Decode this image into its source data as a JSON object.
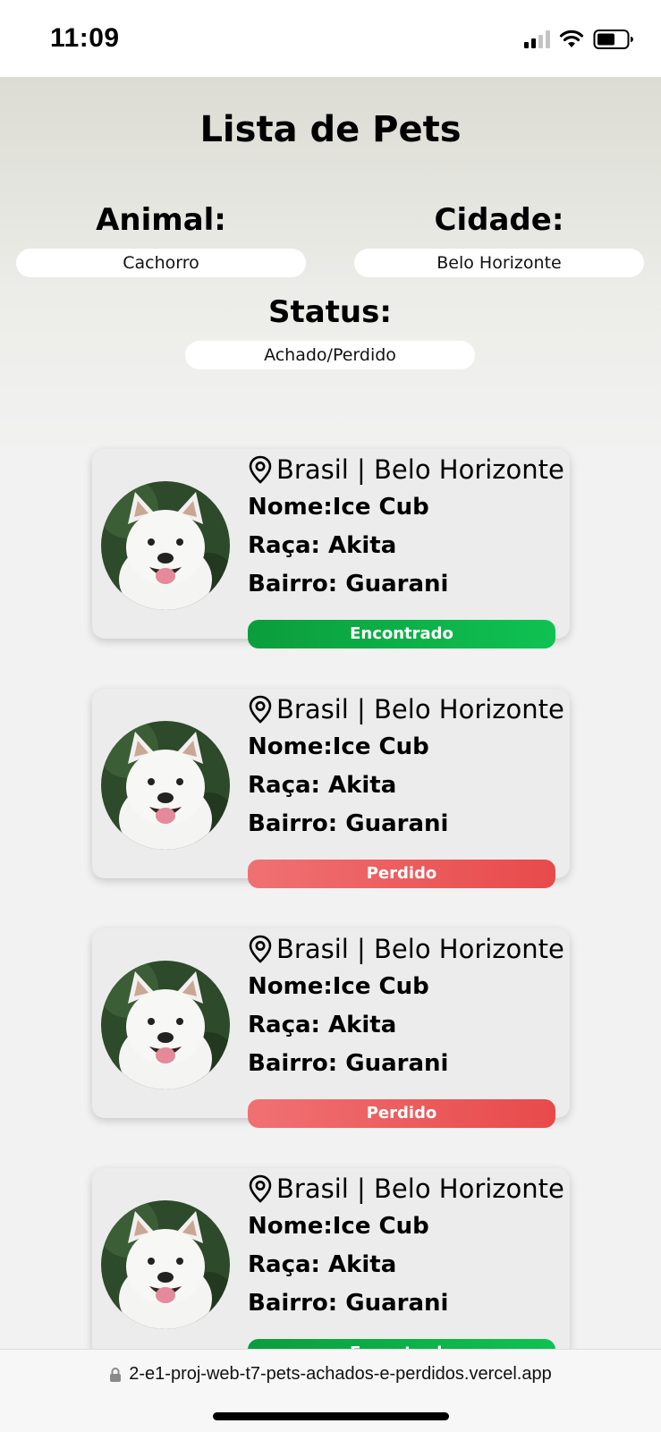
{
  "status_bar": {
    "time": "11:09"
  },
  "page": {
    "title": "Lista de Pets",
    "filters": {
      "animal": {
        "label": "Animal:",
        "value": "Cachorro"
      },
      "cidade": {
        "label": "Cidade:",
        "value": "Belo Horizonte"
      },
      "status": {
        "label": "Status:",
        "value": "Achado/Perdido"
      }
    },
    "cards": [
      {
        "location": "Brasil | Belo Horizonte",
        "nome": "Nome:Ice Cub",
        "raca": "Raça: Akita",
        "bairro": "Bairro: Guarani",
        "status": "Encontrado",
        "status_color": "#0fb04a"
      },
      {
        "location": "Brasil | Belo Horizonte",
        "nome": "Nome:Ice Cub",
        "raca": "Raça: Akita",
        "bairro": "Bairro: Guarani",
        "status": "Perdido",
        "status_color": "#ec5c5d"
      },
      {
        "location": "Brasil | Belo Horizonte",
        "nome": "Nome:Ice Cub",
        "raca": "Raça: Akita",
        "bairro": "Bairro: Guarani",
        "status": "Perdido",
        "status_color": "#ec5c5d"
      },
      {
        "location": "Brasil | Belo Horizonte",
        "nome": "Nome:Ice Cub",
        "raca": "Raça: Akita",
        "bairro": "Bairro: Guarani",
        "status": "Encontrado",
        "status_color": "#0fb04a"
      }
    ]
  },
  "browser": {
    "url": "2-e1-proj-web-t7-pets-achados-e-perdidos.vercel.app"
  },
  "icons": {
    "signal": "cellular-signal-icon",
    "wifi": "wifi-icon",
    "battery": "battery-icon",
    "location": "location-pin-icon",
    "lock": "lock-icon"
  }
}
